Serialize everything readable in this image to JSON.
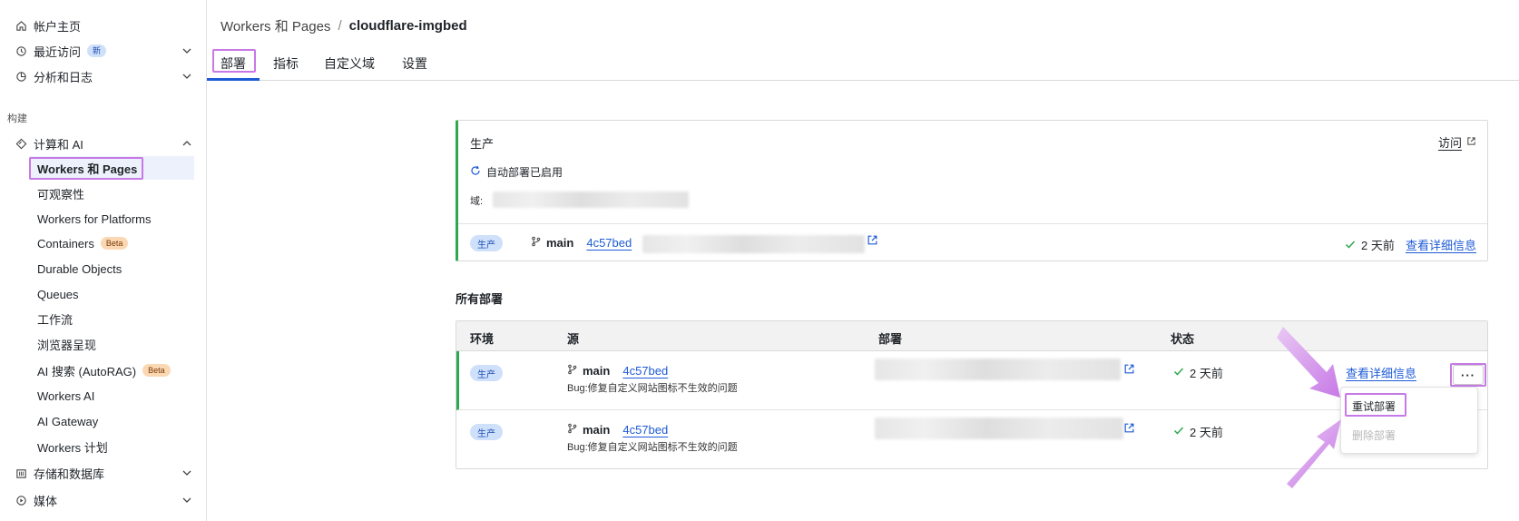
{
  "sidebar": {
    "home": "帐户主页",
    "recent": "最近访问",
    "recent_badge": "新",
    "analytics": "分析和日志",
    "section_build": "构建",
    "compute": "计算和 AI",
    "items": [
      {
        "label": "Workers 和 Pages"
      },
      {
        "label": "可观察性"
      },
      {
        "label": "Workers for Platforms"
      },
      {
        "label": "Containers",
        "badge": "Beta"
      },
      {
        "label": "Durable Objects"
      },
      {
        "label": "Queues"
      },
      {
        "label": "工作流"
      },
      {
        "label": "浏览器呈现"
      },
      {
        "label": "AI 搜索 (AutoRAG)",
        "badge": "Beta"
      },
      {
        "label": "Workers AI"
      },
      {
        "label": "AI Gateway"
      },
      {
        "label": "Workers 计划"
      }
    ],
    "storage": "存储和数据库",
    "media": "媒体"
  },
  "breadcrumb": {
    "parent": "Workers 和 Pages",
    "separator": "/",
    "current": "cloudflare-imgbed"
  },
  "tabs": [
    {
      "label": "部署",
      "active": true
    },
    {
      "label": "指标"
    },
    {
      "label": "自定义域"
    },
    {
      "label": "设置"
    }
  ],
  "production": {
    "title": "生产",
    "visit": "访问",
    "auto_deploy": "自动部署已启用",
    "domain_label": "域:",
    "env_badge": "生产",
    "branch": "main",
    "commit": "4c57bed",
    "age": "2 天前",
    "details": "查看详细信息"
  },
  "all_deployments": {
    "title": "所有部署",
    "headers": [
      "环境",
      "源",
      "部署",
      "状态"
    ],
    "rows": [
      {
        "env": "生产",
        "branch": "main",
        "commit": "4c57bed",
        "message": "Bug:修复自定义网站图标不生效的问题",
        "status": "2 天前",
        "details": "查看详细信息"
      },
      {
        "env": "生产",
        "branch": "main",
        "commit": "4c57bed",
        "message": "Bug:修复自定义网站图标不生效的问题",
        "status": "2 天前"
      }
    ],
    "more": "···",
    "menu": {
      "retry": "重试部署",
      "delete": "删除部署"
    }
  },
  "colors": {
    "accent": "#1e5bd6",
    "success": "#2fa84f",
    "highlight": "#c779e6",
    "badge_bg": "#cfe0fa",
    "beta_bg": "#fbd8b4"
  }
}
